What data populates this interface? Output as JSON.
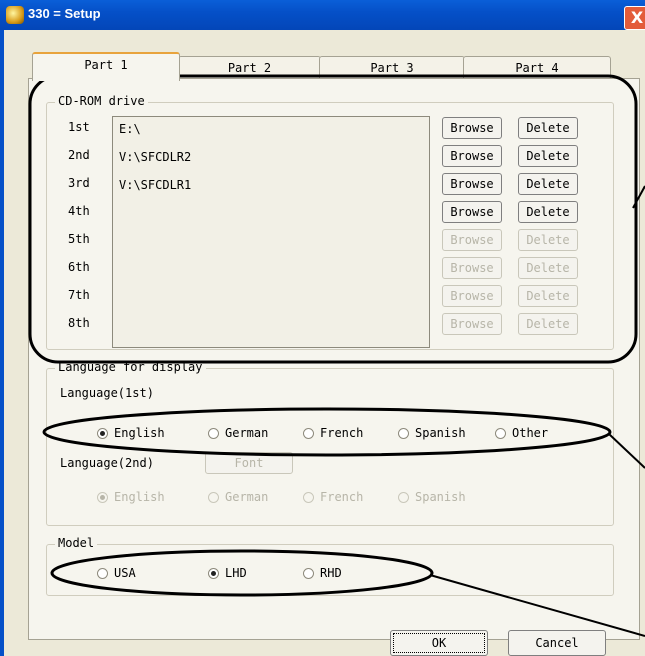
{
  "window": {
    "title": "330 = Setup",
    "close_glyph": "X"
  },
  "tabs": [
    "Part 1",
    "Part 2",
    "Part 3",
    "Part 4"
  ],
  "cdrom": {
    "legend": "CD-ROM drive",
    "rows": [
      {
        "label": "1st",
        "path": "E:\\"
      },
      {
        "label": "2nd",
        "path": "V:\\SFCDLR2"
      },
      {
        "label": "3rd",
        "path": "V:\\SFCDLR1"
      },
      {
        "label": "4th",
        "path": ""
      },
      {
        "label": "5th",
        "path": ""
      },
      {
        "label": "6th",
        "path": ""
      },
      {
        "label": "7th",
        "path": ""
      },
      {
        "label": "8th",
        "path": ""
      }
    ],
    "browse_label": "Browse",
    "delete_label": "Delete",
    "enabled_rows": 4
  },
  "language": {
    "legend": "Language for display",
    "first_label": "Language(1st)",
    "first_options": [
      "English",
      "German",
      "French",
      "Spanish",
      "Other"
    ],
    "first_selected": "English",
    "second_label": "Language(2nd)",
    "font_button": "Font",
    "second_options": [
      "English",
      "German",
      "French",
      "Spanish"
    ],
    "second_selected": "English"
  },
  "model": {
    "legend": "Model",
    "options": [
      "USA",
      "LHD",
      "RHD"
    ],
    "selected": "LHD"
  },
  "footer": {
    "ok_label": "OK",
    "cancel_label": "Cancel"
  }
}
